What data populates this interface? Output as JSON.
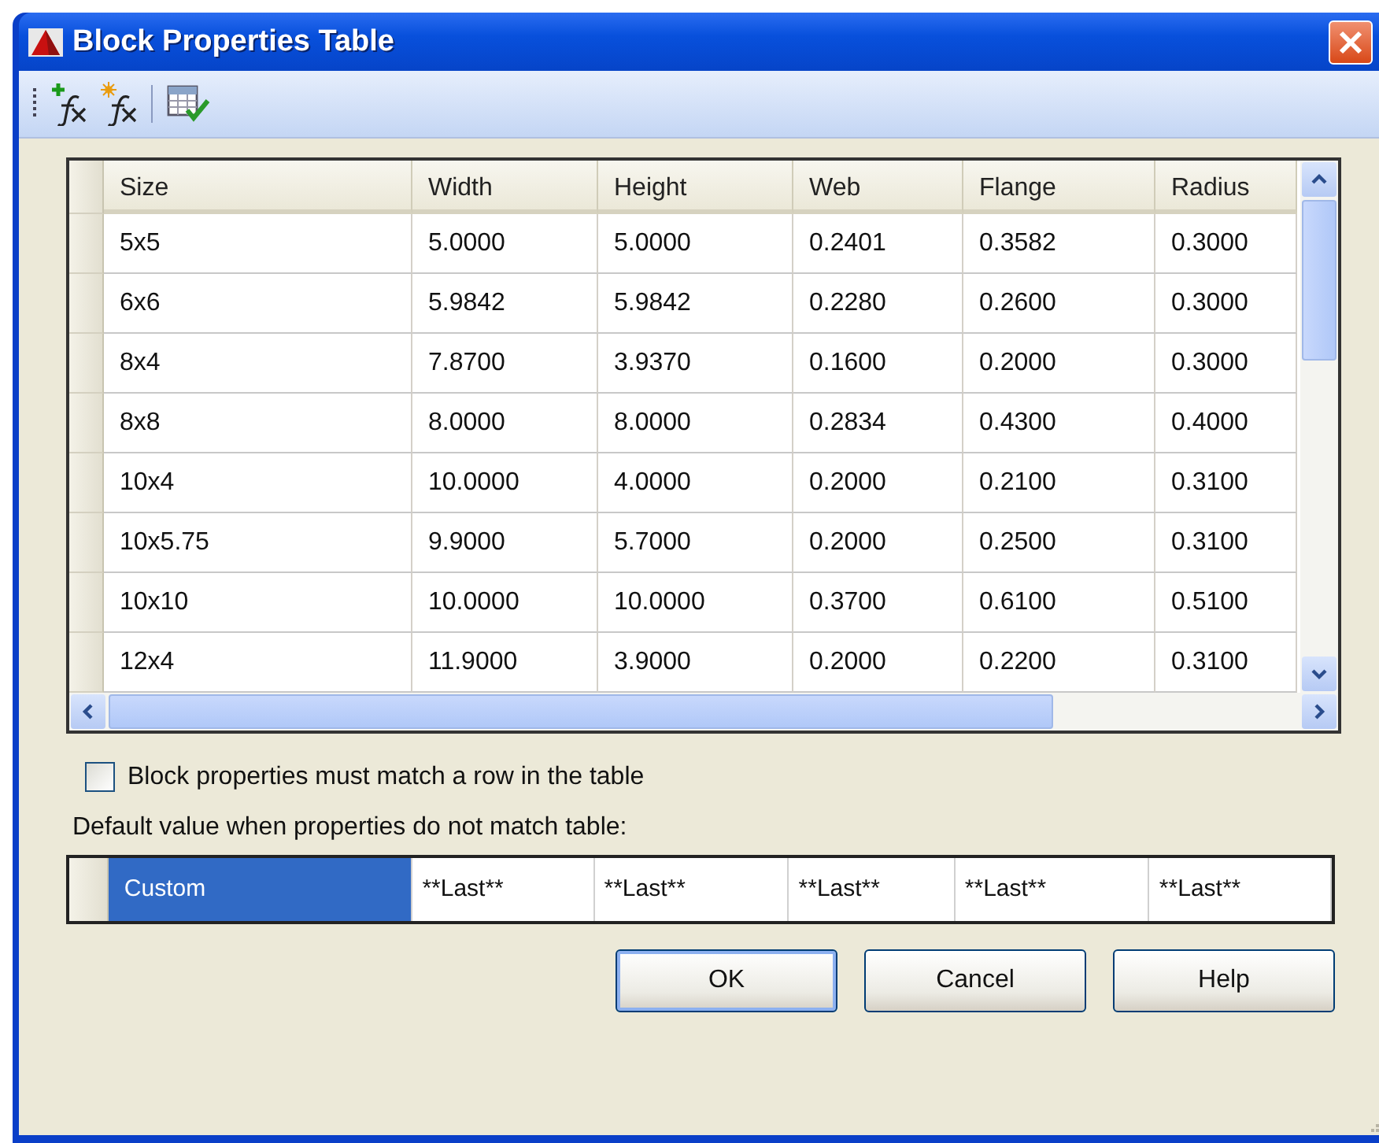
{
  "window": {
    "title": "Block Properties Table"
  },
  "toolbar": {
    "buttons": [
      {
        "kind": "add-fx"
      },
      {
        "kind": "new-fx"
      },
      {
        "kind": "separator"
      },
      {
        "kind": "audit"
      }
    ]
  },
  "table": {
    "columns": [
      "Size",
      "Width",
      "Height",
      "Web",
      "Flange",
      "Radius"
    ],
    "rows": [
      [
        "5x5",
        "5.0000",
        "5.0000",
        "0.2401",
        "0.3582",
        "0.3000"
      ],
      [
        "6x6",
        "5.9842",
        "5.9842",
        "0.2280",
        "0.2600",
        "0.3000"
      ],
      [
        "8x4",
        "7.8700",
        "3.9370",
        "0.1600",
        "0.2000",
        "0.3000"
      ],
      [
        "8x8",
        "8.0000",
        "8.0000",
        "0.2834",
        "0.4300",
        "0.4000"
      ],
      [
        "10x4",
        "10.0000",
        "4.0000",
        "0.2000",
        "0.2100",
        "0.3100"
      ],
      [
        "10x5.75",
        "9.9000",
        "5.7000",
        "0.2000",
        "0.2500",
        "0.3100"
      ],
      [
        "10x10",
        "10.0000",
        "10.0000",
        "0.3700",
        "0.6100",
        "0.5100"
      ],
      [
        "12x4",
        "11.9000",
        "3.9000",
        "0.2000",
        "0.2200",
        "0.3100"
      ]
    ]
  },
  "match_checkbox": {
    "label": "Block properties must match a row in the table",
    "checked": false
  },
  "default_label": "Default value when properties do not match table:",
  "default_values": [
    {
      "text": "Custom",
      "selected": true
    },
    {
      "text": "**Last**",
      "selected": false
    },
    {
      "text": "**Last**",
      "selected": false
    },
    {
      "text": "**Last**",
      "selected": false
    },
    {
      "text": "**Last**",
      "selected": false
    },
    {
      "text": "**Last**",
      "selected": false
    }
  ],
  "buttons": [
    {
      "label": "OK",
      "default": true
    },
    {
      "label": "Cancel",
      "default": false
    },
    {
      "label": "Help",
      "default": false
    }
  ]
}
